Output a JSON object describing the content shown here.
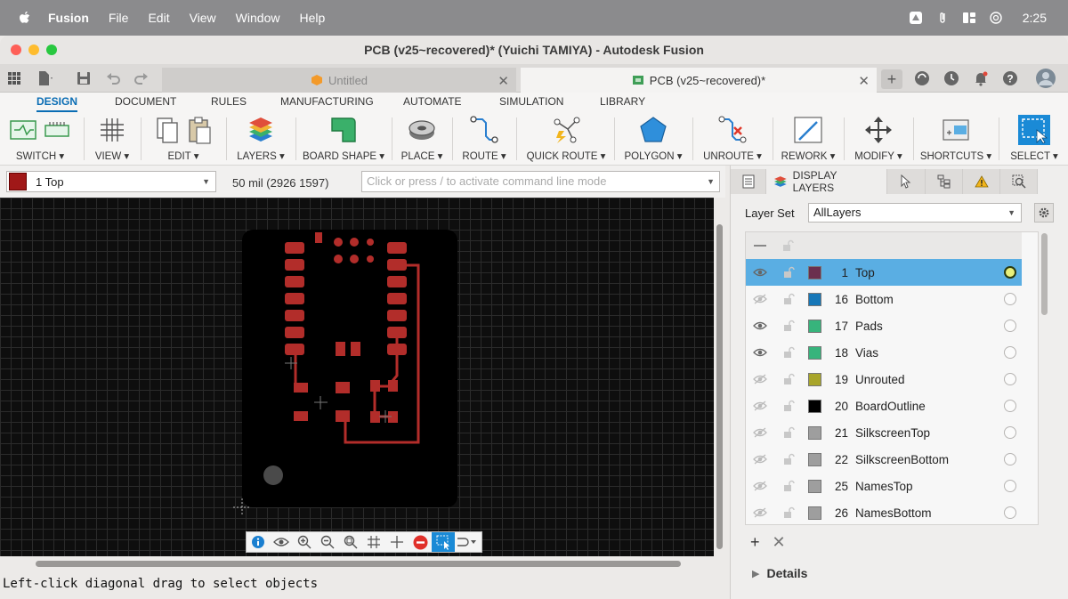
{
  "menubar": {
    "app": "Fusion",
    "items": [
      "File",
      "Edit",
      "View",
      "Window",
      "Help"
    ],
    "clock": "2:25"
  },
  "window": {
    "title": "PCB (v25~recovered)* (Yuichi TAMIYA) - Autodesk Fusion"
  },
  "tabs": {
    "inactive": "Untitled",
    "active": "PCB (v25~recovered)*"
  },
  "ribbon_tabs": [
    "DESIGN",
    "DOCUMENT",
    "RULES",
    "MANUFACTURING",
    "AUTOMATE",
    "SIMULATION",
    "LIBRARY"
  ],
  "toolbar": {
    "switch": "SWITCH ▾",
    "view": "VIEW ▾",
    "edit": "EDIT ▾",
    "layers": "LAYERS ▾",
    "board_shape": "BOARD SHAPE ▾",
    "place": "PLACE ▾",
    "route": "ROUTE ▾",
    "quick_route": "QUICK ROUTE ▾",
    "polygon": "POLYGON ▾",
    "unroute": "UNROUTE ▾",
    "rework": "REWORK ▾",
    "modify": "MODIFY ▾",
    "shortcuts": "SHORTCUTS ▾",
    "select": "SELECT ▾"
  },
  "options": {
    "layer": "1 Top",
    "coord": "50 mil (2926 1597)",
    "cmd_placeholder": "Click or press / to activate command line mode"
  },
  "status": "Left-click diagonal drag to select objects",
  "panel": {
    "tab_label": "DISPLAY LAYERS",
    "layer_set_label": "Layer Set",
    "layer_set_value": "AllLayers",
    "details": "Details",
    "layers": [
      {
        "num": "1",
        "name": "Top",
        "color": "#6b2f4e",
        "visible": true,
        "selected": true
      },
      {
        "num": "16",
        "name": "Bottom",
        "color": "#1677b8",
        "visible": false,
        "selected": false
      },
      {
        "num": "17",
        "name": "Pads",
        "color": "#37b47c",
        "visible": true,
        "selected": false
      },
      {
        "num": "18",
        "name": "Vias",
        "color": "#37b47c",
        "visible": true,
        "selected": false
      },
      {
        "num": "19",
        "name": "Unrouted",
        "color": "#a8a52a",
        "visible": false,
        "selected": false
      },
      {
        "num": "20",
        "name": "BoardOutline",
        "color": "#000000",
        "visible": false,
        "selected": false
      },
      {
        "num": "21",
        "name": "SilkscreenTop",
        "color": "#9e9e9e",
        "visible": false,
        "selected": false
      },
      {
        "num": "22",
        "name": "SilkscreenBottom",
        "color": "#9e9e9e",
        "visible": false,
        "selected": false
      },
      {
        "num": "25",
        "name": "NamesTop",
        "color": "#9e9e9e",
        "visible": false,
        "selected": false
      },
      {
        "num": "26",
        "name": "NamesBottom",
        "color": "#9e9e9e",
        "visible": false,
        "selected": false
      }
    ]
  }
}
